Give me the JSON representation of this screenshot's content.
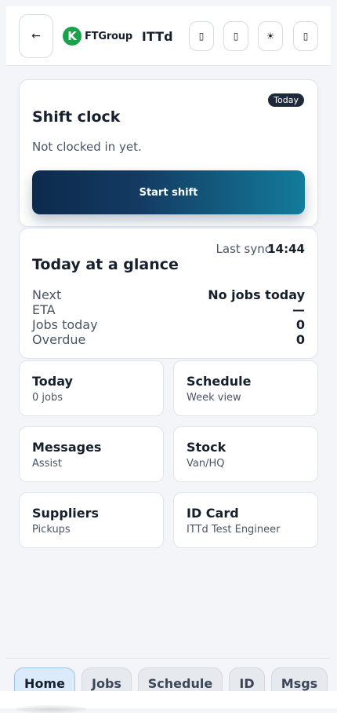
{
  "header": {
    "back_glyph": "←",
    "logo_letter": "K",
    "logo_text": "FTGroup",
    "title": "ITTd",
    "icons": [
      {
        "name": "icon-1",
        "glyph": "▯"
      },
      {
        "name": "icon-2",
        "glyph": "▯"
      },
      {
        "name": "theme-toggle-icon",
        "glyph": "☀"
      },
      {
        "name": "icon-4",
        "glyph": "▯"
      }
    ]
  },
  "shift": {
    "title": "Shift clock",
    "badge": "Today",
    "status": "Not clocked in yet.",
    "button_label": "Start shift"
  },
  "glance": {
    "title": "Today at a glance",
    "sync_label": "Last sync",
    "sync_time": "14:44",
    "rows": [
      {
        "key": "Next",
        "value": "No jobs today"
      },
      {
        "key": "ETA",
        "value": "—"
      },
      {
        "key": "Jobs today",
        "value": "0"
      },
      {
        "key": "Overdue",
        "value": "0"
      }
    ]
  },
  "tiles": [
    {
      "title": "Today",
      "subtitle": "0 jobs"
    },
    {
      "title": "Schedule",
      "subtitle": "Week view"
    },
    {
      "title": "Messages",
      "subtitle": "Assist"
    },
    {
      "title": "Stock",
      "subtitle": "Van/HQ"
    },
    {
      "title": "Suppliers",
      "subtitle": "Pickups"
    },
    {
      "title": "ID Card",
      "subtitle": "ITTd Test Engineer"
    }
  ],
  "nav": {
    "tabs": [
      "Home",
      "Jobs",
      "Schedule",
      "ID",
      "Msgs"
    ],
    "active": "Home"
  },
  "colors": {
    "accent_dark": "#0c2a4d",
    "accent_teal": "#137c9c",
    "brand_green": "#17a34a",
    "badge_bg": "#1e2a3a"
  }
}
